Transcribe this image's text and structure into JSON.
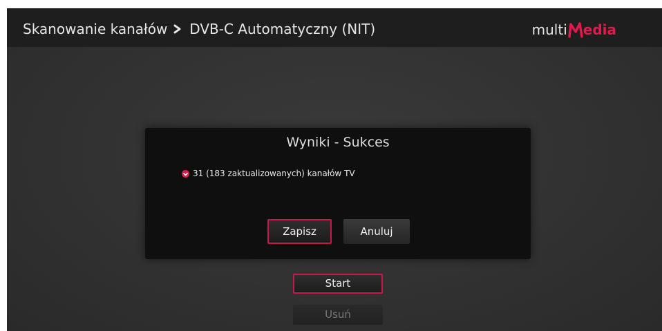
{
  "header": {
    "breadcrumb_parent": "Skanowanie kanałów",
    "breadcrumb_current": "DVB-C Automatyczny (NIT)",
    "logo": {
      "prefix": "multi",
      "suffix": "edia",
      "accent_color": "#e6174e"
    }
  },
  "dialog": {
    "title": "Wyniki - Sukces",
    "result_text": "31 (183 zaktualizowanych) kanałów TV",
    "result_icon": "red-check-bullet-icon",
    "buttons": {
      "save_label": "Zapisz",
      "cancel_label": "Anuluj"
    }
  },
  "actions": {
    "start_label": "Start",
    "delete_label": "Usuń",
    "delete_state": "disabled"
  },
  "colors": {
    "focus_border": "#c8174a",
    "background": "#333333"
  }
}
